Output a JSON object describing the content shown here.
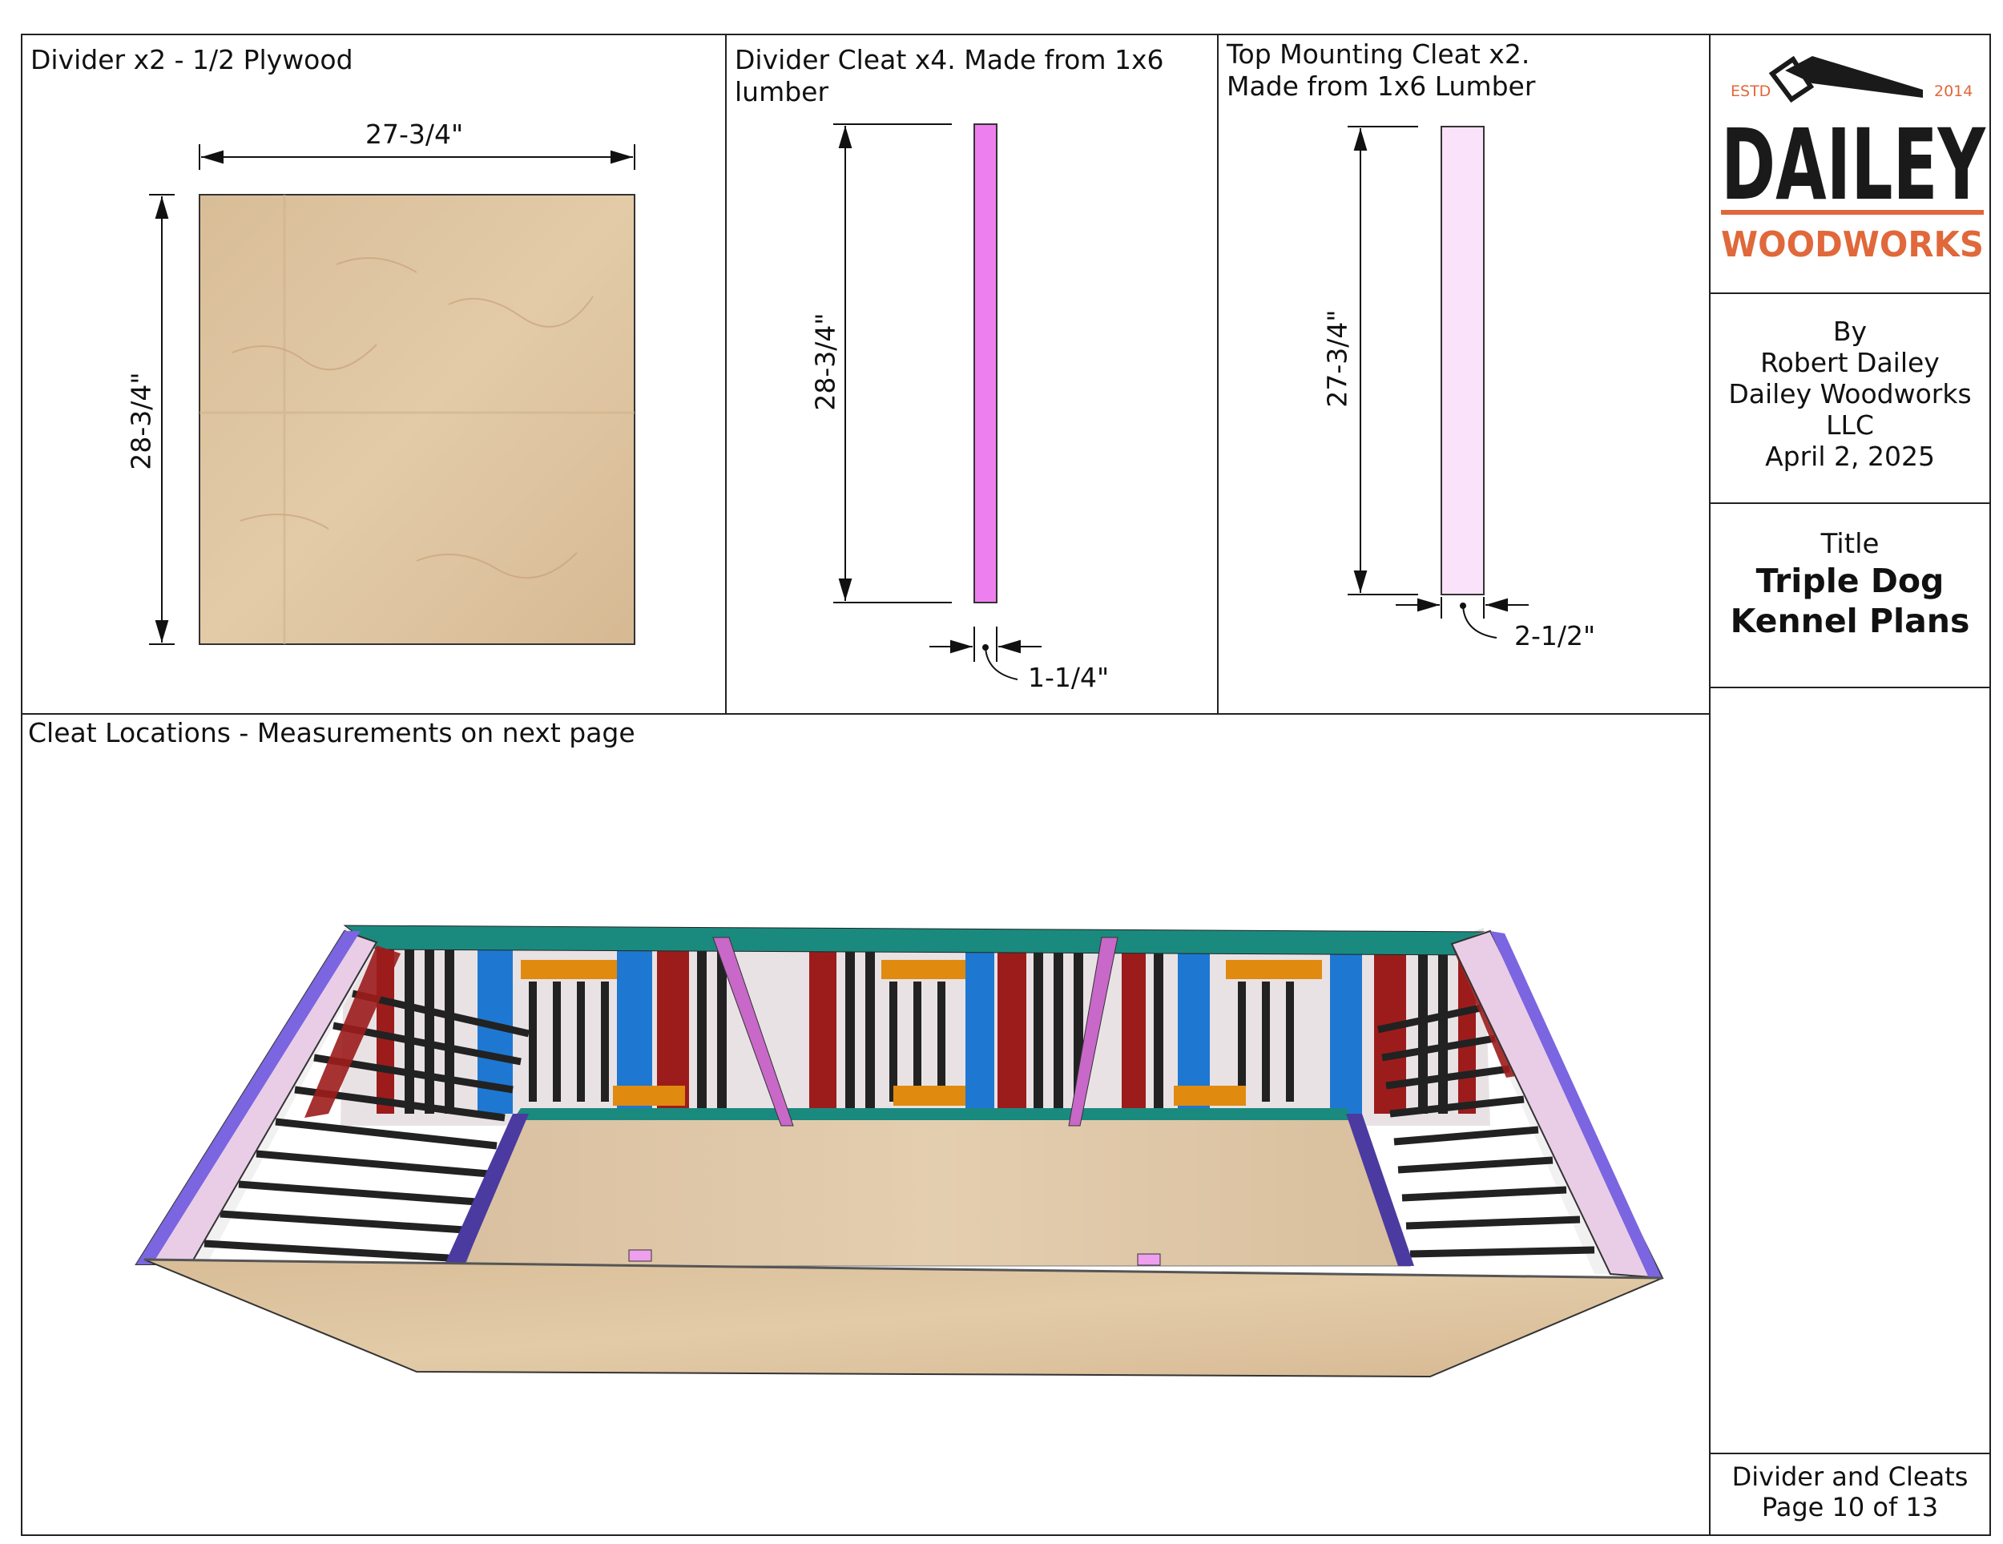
{
  "panels": {
    "divider": {
      "caption": "Divider x2 - 1/2 Plywood",
      "width_dim": "27-3/4\"",
      "height_dim": "28-3/4\""
    },
    "divider_cleat": {
      "caption_line1": "Divider Cleat x4. Made from 1x6",
      "caption_line2": "lumber",
      "length_dim": "28-3/4\"",
      "width_dim": "1-1/4\""
    },
    "top_cleat": {
      "caption_line1": "Top Mounting Cleat x2.",
      "caption_line2": "Made from 1x6 Lumber",
      "length_dim": "27-3/4\"",
      "width_dim": "2-1/2\""
    },
    "cleat_locations": {
      "caption": "Cleat Locations - Measurements on next page"
    }
  },
  "title_block": {
    "logo": {
      "estd": "ESTD",
      "year": "2014",
      "name": "DAILEY",
      "sub": "WOODWORKS"
    },
    "by_lines": [
      "By",
      "Robert Dailey",
      "Dailey Woodworks",
      "LLC",
      "April 2, 2025"
    ],
    "title_label": "Title",
    "title_line1": "Triple Dog",
    "title_line2": "Kennel Plans",
    "sheet_name": "Divider and Cleats",
    "page": "Page 10 of 13"
  },
  "colors": {
    "plywood": "#dcc29c",
    "divider_cleat": "#ee7fee",
    "top_cleat": "#fbe2fb",
    "teal": "#1a8a7e",
    "red": "#9c1c1c",
    "blue": "#1e78d2",
    "orange": "#e08a10",
    "purple": "#7b65e0",
    "logo_orange": "#e0683a"
  }
}
